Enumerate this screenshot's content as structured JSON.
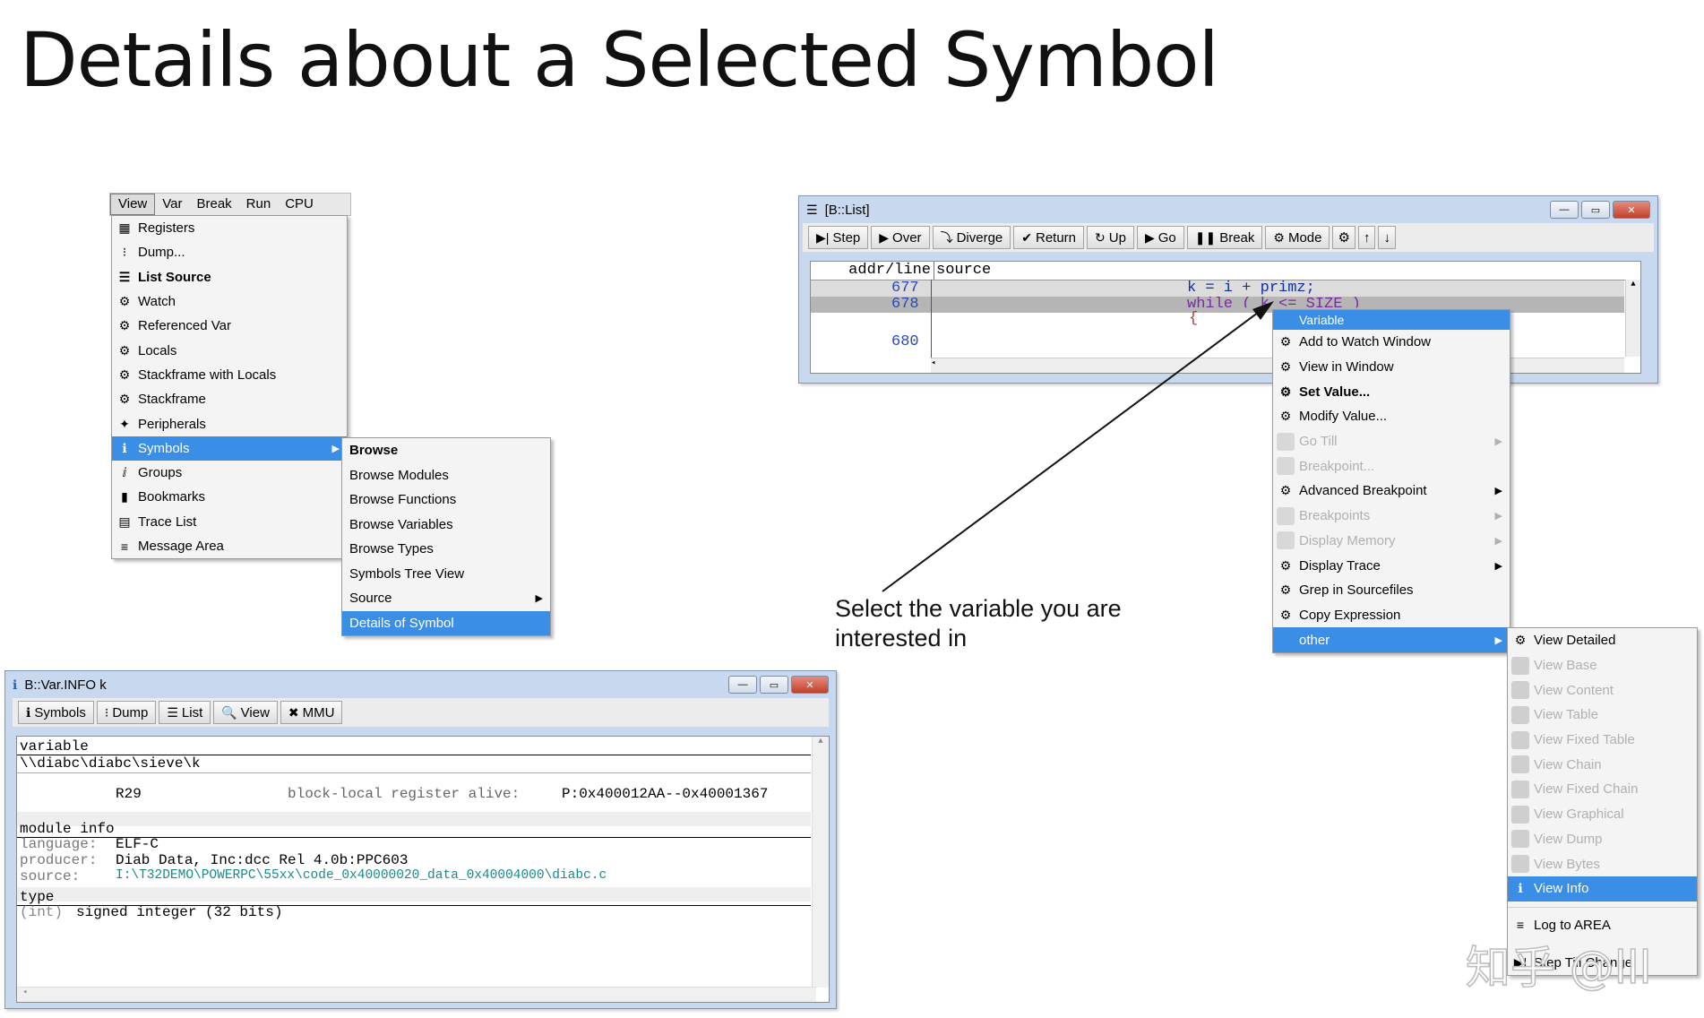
{
  "title": "Details about a Selected Symbol",
  "menubar": {
    "items": [
      "View",
      "Var",
      "Break",
      "Run",
      "CPU"
    ]
  },
  "view_menu": {
    "items": [
      {
        "label": "Registers",
        "icon": "registers-icon",
        "glyph": "▦"
      },
      {
        "label": "Dump...",
        "icon": "dump-icon",
        "glyph": "⁝"
      },
      {
        "label": "List Source",
        "icon": "list-source-icon",
        "glyph": "☰",
        "bold": true
      },
      {
        "label": "Watch",
        "icon": "watch-icon",
        "glyph": "⚙"
      },
      {
        "label": "Referenced Var",
        "icon": "referenced-var-icon",
        "glyph": "⚙"
      },
      {
        "label": "Locals",
        "icon": "locals-icon",
        "glyph": "⚙"
      },
      {
        "label": "Stackframe with Locals",
        "icon": "stackframe-locals-icon",
        "glyph": "⚙"
      },
      {
        "label": "Stackframe",
        "icon": "stackframe-icon",
        "glyph": "⚙"
      },
      {
        "label": "Peripherals",
        "icon": "peripherals-icon",
        "glyph": "✦"
      },
      {
        "label": "Symbols",
        "icon": "symbols-icon",
        "glyph": "ℹ",
        "selected": true,
        "submenu": true
      },
      {
        "label": "Groups",
        "icon": "groups-icon",
        "glyph": "ⅈ"
      },
      {
        "label": "Bookmarks",
        "icon": "bookmarks-icon",
        "glyph": "▮"
      },
      {
        "label": "Trace List",
        "icon": "trace-list-icon",
        "glyph": "▤"
      },
      {
        "label": "Message Area",
        "icon": "message-area-icon",
        "glyph": "≡"
      }
    ]
  },
  "symbols_submenu": {
    "items": [
      {
        "label": "Browse",
        "bold": true
      },
      {
        "label": "Browse Modules"
      },
      {
        "label": "Browse Functions"
      },
      {
        "label": "Browse Variables"
      },
      {
        "label": "Browse Types"
      },
      {
        "label": "Symbols Tree View"
      },
      {
        "label": "Source",
        "submenu": true
      },
      {
        "label": "Details of Symbol",
        "selected": true
      }
    ]
  },
  "list_window": {
    "title": "[B::List]",
    "toolbar": [
      {
        "label": "Step",
        "glyph": "▶|"
      },
      {
        "label": "Over",
        "glyph": "▶"
      },
      {
        "label": "Diverge",
        "glyph": "⤵"
      },
      {
        "label": "Return",
        "glyph": "✔"
      },
      {
        "label": "Up",
        "glyph": "↻"
      },
      {
        "label": "Go",
        "glyph": "▶"
      },
      {
        "label": "Break",
        "glyph": "❚❚"
      },
      {
        "label": "Mode",
        "glyph": "⚙"
      }
    ],
    "header_addr": "addr/line",
    "header_source": "source",
    "rows": [
      {
        "line": "677",
        "code": "k = i + primz;"
      },
      {
        "line": "678",
        "code": "while ( k <= SIZE )"
      },
      {
        "line": "",
        "code": "{"
      },
      {
        "line": "680",
        "code": ""
      }
    ]
  },
  "context_menu": {
    "header": "Variable",
    "items": [
      {
        "label": "Add to Watch Window",
        "icon": "watch-icon"
      },
      {
        "label": "View in Window",
        "icon": "view-window-icon"
      },
      {
        "label": "Set Value...",
        "icon": "set-value-icon",
        "bold": true
      },
      {
        "label": "Modify Value...",
        "icon": "modify-value-icon"
      },
      {
        "label": "Go Till",
        "icon": "go-till-icon",
        "disabled": true,
        "submenu": true
      },
      {
        "label": "Breakpoint...",
        "icon": "breakpoint-icon",
        "disabled": true
      },
      {
        "label": "Advanced Breakpoint",
        "icon": "advanced-breakpoint-icon",
        "submenu": true
      },
      {
        "label": "Breakpoints",
        "icon": "breakpoints-icon",
        "disabled": true,
        "submenu": true
      },
      {
        "label": "Display Memory",
        "icon": "display-memory-icon",
        "disabled": true,
        "submenu": true
      },
      {
        "label": "Display Trace",
        "icon": "display-trace-icon",
        "submenu": true
      },
      {
        "label": "Grep in Sourcefiles",
        "icon": "grep-icon"
      },
      {
        "label": "Copy Expression",
        "icon": "copy-icon"
      },
      {
        "label": "other",
        "icon": "",
        "selected": true,
        "submenu": true
      }
    ]
  },
  "other_submenu": {
    "items": [
      {
        "label": "View Detailed",
        "icon": "view-detailed-icon"
      },
      {
        "label": "View Base",
        "disabled": true
      },
      {
        "label": "View Content",
        "disabled": true
      },
      {
        "label": "View Table",
        "disabled": true
      },
      {
        "label": "View Fixed Table",
        "disabled": true
      },
      {
        "label": "View Chain",
        "disabled": true
      },
      {
        "label": "View Fixed Chain",
        "disabled": true
      },
      {
        "label": "View Graphical",
        "disabled": true
      },
      {
        "label": "View Dump",
        "disabled": true
      },
      {
        "label": "View Bytes",
        "disabled": true
      },
      {
        "label": "View Info",
        "selected": true
      },
      {
        "label": "Log to AREA"
      },
      {
        "label": "Step Till Change"
      }
    ]
  },
  "annotation": {
    "line1": "Select the variable you are",
    "line2": "interested in"
  },
  "info_window": {
    "title": "B::Var.INFO k",
    "toolbar": [
      {
        "label": "Symbols",
        "glyph": "ℹ"
      },
      {
        "label": "Dump",
        "glyph": "⁝"
      },
      {
        "label": "List",
        "glyph": "☰"
      },
      {
        "label": "View",
        "glyph": "🔍"
      },
      {
        "label": "MMU",
        "glyph": "✖"
      }
    ],
    "section_variable": "variable",
    "variable_path": "\\\\diabc\\diabc\\sieve\\k",
    "register": "R29",
    "register_info": "block-local register alive:",
    "register_range": "P:0x400012AA--0x40001367",
    "section_module": "module info",
    "module_rows": [
      {
        "key": "language:",
        "value": "ELF-C"
      },
      {
        "key": "producer:",
        "value": "Diab Data, Inc:dcc Rel 4.0b:PPC603"
      },
      {
        "key": "source:",
        "value": "I:\\T32DEMO\\POWERPC\\55xx\\code_0x40000020_data_0x40004000\\diabc.c"
      }
    ],
    "section_type": "type",
    "type_prefix": "(int)",
    "type_value": "signed integer (32 bits)"
  },
  "watermark": "知乎 @lll",
  "colors": {
    "selection": "#3a8ee6",
    "link_teal": "#1a8a8a",
    "line_number_blue": "#2848b8"
  }
}
